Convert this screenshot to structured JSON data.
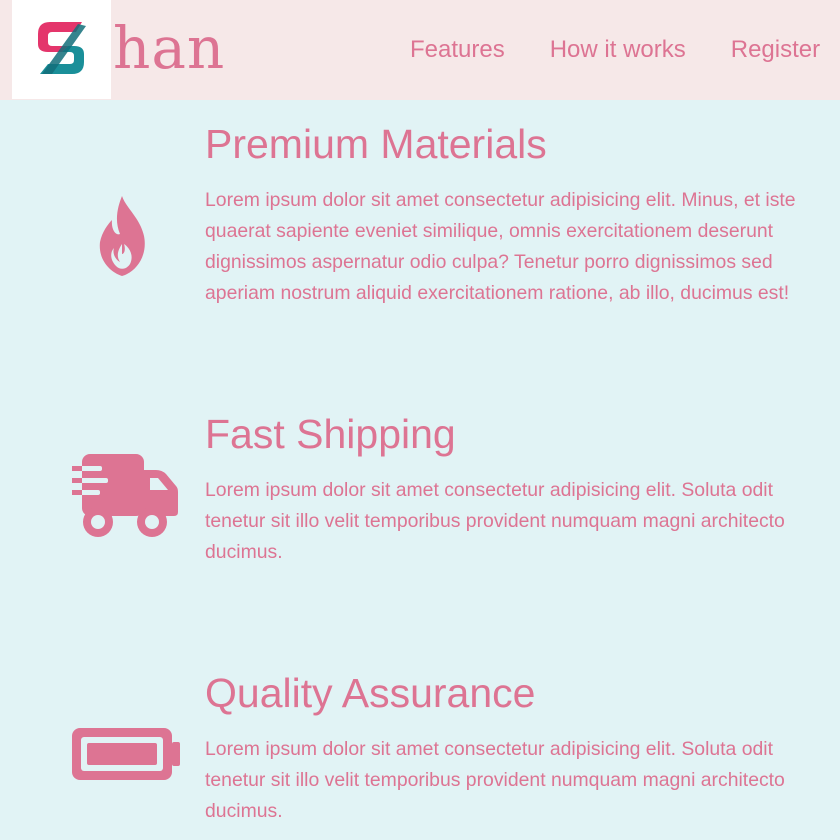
{
  "colors": {
    "accent": "#dd7493",
    "background": "#e1f3f5",
    "header_background": "#f6e8e8",
    "logo_teal": "#1a8f99",
    "logo_pink": "#e4356b"
  },
  "header": {
    "logo_icon": "s-logo-icon",
    "brand_text": "han",
    "nav": [
      {
        "label": "Features"
      },
      {
        "label": "How it works"
      },
      {
        "label": "Register"
      }
    ]
  },
  "features": [
    {
      "icon": "fire-icon",
      "title": "Premium Materials",
      "text": "Lorem ipsum dolor sit amet consectetur adipisicing elit. Minus, et iste quaerat sapiente eveniet similique, omnis exercitationem deserunt dignissimos aspernatur odio culpa? Tenetur porro dignissimos sed aperiam nostrum aliquid exercitationem ratione, ab illo, ducimus est!"
    },
    {
      "icon": "shipping-truck-icon",
      "title": "Fast Shipping",
      "text": "Lorem ipsum dolor sit amet consectetur adipisicing elit. Soluta odit tenetur sit illo velit temporibus provident numquam magni architecto ducimus."
    },
    {
      "icon": "battery-full-icon",
      "title": "Quality Assurance",
      "text": "Lorem ipsum dolor sit amet consectetur adipisicing elit. Soluta odit tenetur sit illo velit temporibus provident numquam magni architecto ducimus."
    }
  ]
}
